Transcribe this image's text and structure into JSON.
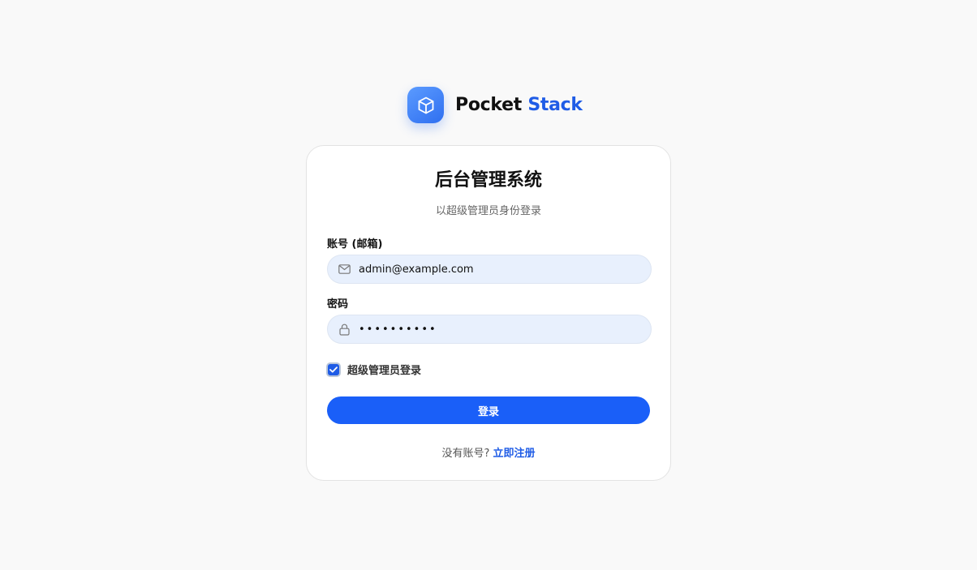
{
  "brand": {
    "name_part1": "Pocket",
    "name_part2": "Stack",
    "logo_icon": "cube-icon",
    "accent_color": "#1f5ce6"
  },
  "card": {
    "title": "后台管理系统",
    "subtitle": "以超级管理员身份登录"
  },
  "form": {
    "email_label": "账号 (邮箱)",
    "email_value": "admin@example.com",
    "email_icon": "mail-icon",
    "password_label": "密码",
    "password_value": "••••••••••",
    "password_icon": "lock-icon",
    "superadmin_checkbox_label": "超级管理员登录",
    "superadmin_checked": true,
    "submit_label": "登录"
  },
  "footer": {
    "prompt": "没有账号?",
    "register_link": "立即注册"
  },
  "colors": {
    "button": "#1a5ff8",
    "input_bg": "#e8f0fd",
    "page_bg": "#f9f9f9"
  }
}
